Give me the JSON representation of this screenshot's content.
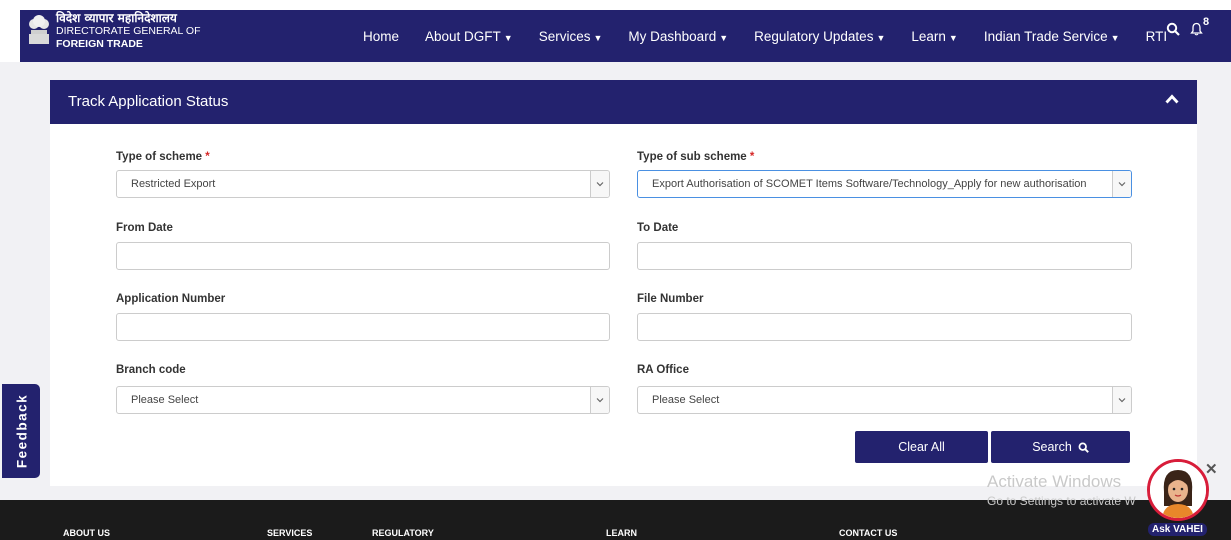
{
  "header": {
    "brand_hindi": "विदेश व्यापार महानिदेशालय",
    "brand_line1": "DIRECTORATE GENERAL OF",
    "brand_line2": "FOREIGN TRADE",
    "nav": [
      {
        "label": "Home"
      },
      {
        "label": "About DGFT"
      },
      {
        "label": "Services"
      },
      {
        "label": "My Dashboard"
      },
      {
        "label": "Regulatory Updates"
      },
      {
        "label": "Learn"
      },
      {
        "label": "Indian Trade Service"
      },
      {
        "label": "RTI"
      }
    ],
    "notification_count": "8"
  },
  "panel": {
    "title": "Track Application Status",
    "scheme_label": "Type of scheme",
    "scheme_value": "Restricted Export",
    "subscheme_label": "Type of sub scheme",
    "subscheme_value": "Export Authorisation of SCOMET Items Software/Technology_Apply for new authorisation",
    "from_date_label": "From Date",
    "from_date_value": "",
    "to_date_label": "To Date",
    "to_date_value": "",
    "app_number_label": "Application Number",
    "app_number_value": "",
    "file_number_label": "File Number",
    "file_number_value": "",
    "branch_label": "Branch code",
    "branch_value": "Please Select",
    "ra_label": "RA Office",
    "ra_value": "Please Select",
    "required_mark": "*",
    "clear_label": "Clear All",
    "search_label": "Search"
  },
  "feedback_label": "Feedback",
  "footer": {
    "links": [
      "ABOUT US",
      "SERVICES",
      "REGULATORY",
      "LEARN",
      "CONTACT US"
    ]
  },
  "watermark": {
    "line1": "Activate Windows",
    "line2": "Go to Settings to activate W"
  },
  "assistant_label": "Ask VAHEI",
  "colors": {
    "primary": "#23226e",
    "required": "#d62828",
    "accent_ring": "#d81d3a"
  }
}
